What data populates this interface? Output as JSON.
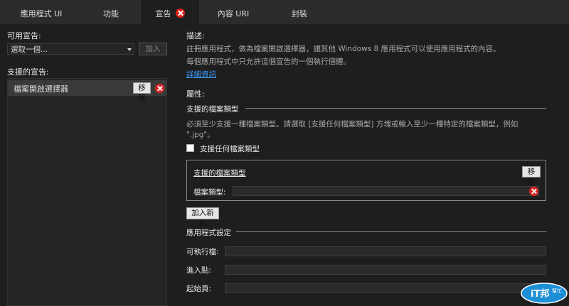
{
  "tabs": [
    {
      "label": "應用程式 UI",
      "active": false
    },
    {
      "label": "功能",
      "active": false
    },
    {
      "label": "宣告",
      "active": true
    },
    {
      "label": "內容 URI",
      "active": false
    },
    {
      "label": "封裝",
      "active": false
    }
  ],
  "left": {
    "available_label": "可用宣告:",
    "select_value": "選取一個...",
    "add_button": "加入",
    "supported_label": "支援的宣告:",
    "declarations": [
      {
        "label": "檔案開啟選擇器",
        "remove": "移除"
      }
    ]
  },
  "right": {
    "description_heading": "描述:",
    "description_line1": "註冊應用程式，做為檔案開啟選擇器，讓其他 Windows 8 應用程式可以使用應用程式的內容。",
    "description_line2": "每個應用程式中只允許這個宣告的一個執行個體。",
    "more_info_link": "詳細資訊",
    "properties_heading": "屬性:",
    "supported_types_section": "支援的檔案類型",
    "supported_types_help1": "必須至少支援一種檔案類型。請選取 [支援任何檔案類型] 方塊或輸入至少一種特定的檔案類型，例如",
    "supported_types_help2": "\".jpg\"。",
    "any_type_checkbox": "支援任何檔案類型",
    "any_type_checked": false,
    "type_box": {
      "title": "支援的檔案類型",
      "remove": "移除",
      "file_type_label": "檔案類型:",
      "file_type_value": ""
    },
    "add_new_button": "加入新的",
    "app_settings_section": "應用程式設定",
    "executable_label": "可執行檔:",
    "executable_value": "",
    "entry_point_label": "進入點:",
    "entry_point_value": "",
    "start_page_label": "起始頁:",
    "start_page_value": ""
  },
  "watermark": {
    "brand": "iT邦",
    "sub": "幫忙"
  },
  "colors": {
    "background": "#1e1e1e",
    "tabbar": "#2b2b2b",
    "link": "#3b9cff",
    "error": "#e0201f"
  }
}
